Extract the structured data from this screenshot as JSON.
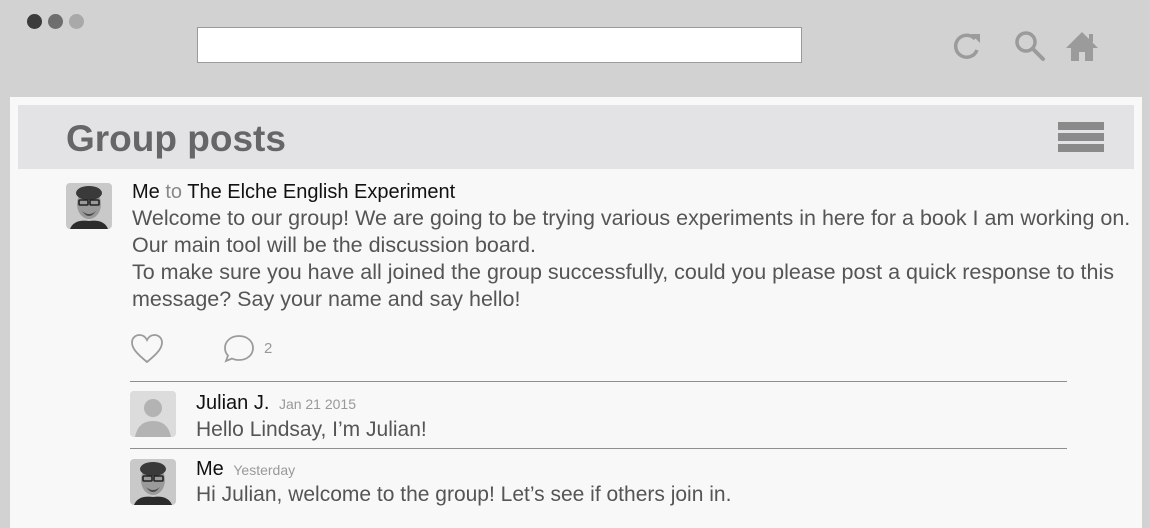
{
  "browser": {
    "url": "",
    "icons": [
      "reload-icon",
      "search-icon",
      "home-icon"
    ]
  },
  "page": {
    "title": "Group posts"
  },
  "post": {
    "author": "Me",
    "to_word": "to",
    "group": "The Elche English Experiment",
    "paragraph1": "Welcome to our group! We are going to be trying various experiments in here for a book I am working on. Our main tool will be the discussion board.",
    "paragraph2": "To make sure you have all joined the group successfully, could you please post a quick response to this message? Say your name and say hello!",
    "comment_count": "2"
  },
  "replies": [
    {
      "author": "Julian J.",
      "date": "Jan 21 2015",
      "text": "Hello Lindsay, I’m Julian!"
    },
    {
      "author": "Me",
      "date": "Yesterday",
      "text": "Hi Julian, welcome to the group! Let’s see if others join in."
    }
  ],
  "colors": {
    "chrome": "#d2d2d3",
    "header": "#e3e3e5",
    "title": "#666666",
    "body_text": "#555555",
    "muted": "#999999"
  }
}
